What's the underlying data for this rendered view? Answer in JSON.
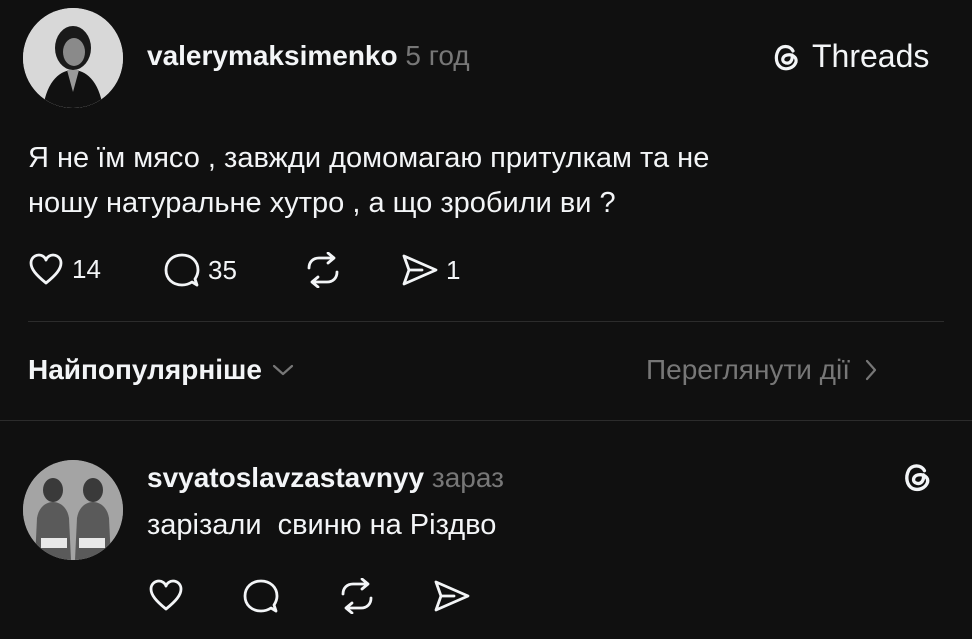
{
  "post": {
    "username": "valerymaksimenko",
    "time": "5 год",
    "text_line1": "Я не їм мясо , завжди домомагаю притулкам та не",
    "text_line2": "ношу натуральне хутро , а що зробили ви ?",
    "likes": "14",
    "replies": "35",
    "shares": "1"
  },
  "brand": {
    "label": "Threads"
  },
  "filter": {
    "sort_label": "Найпопулярніше",
    "activity_label": "Переглянути дії"
  },
  "reply": {
    "username": "svyatoslavzastavnyy",
    "time": "зараз",
    "text": "зарізали  свиню на Різдво"
  },
  "colors": {
    "background": "#101010",
    "text": "#f3f5f7",
    "muted": "#777777",
    "divider": "#2c2c2c"
  }
}
